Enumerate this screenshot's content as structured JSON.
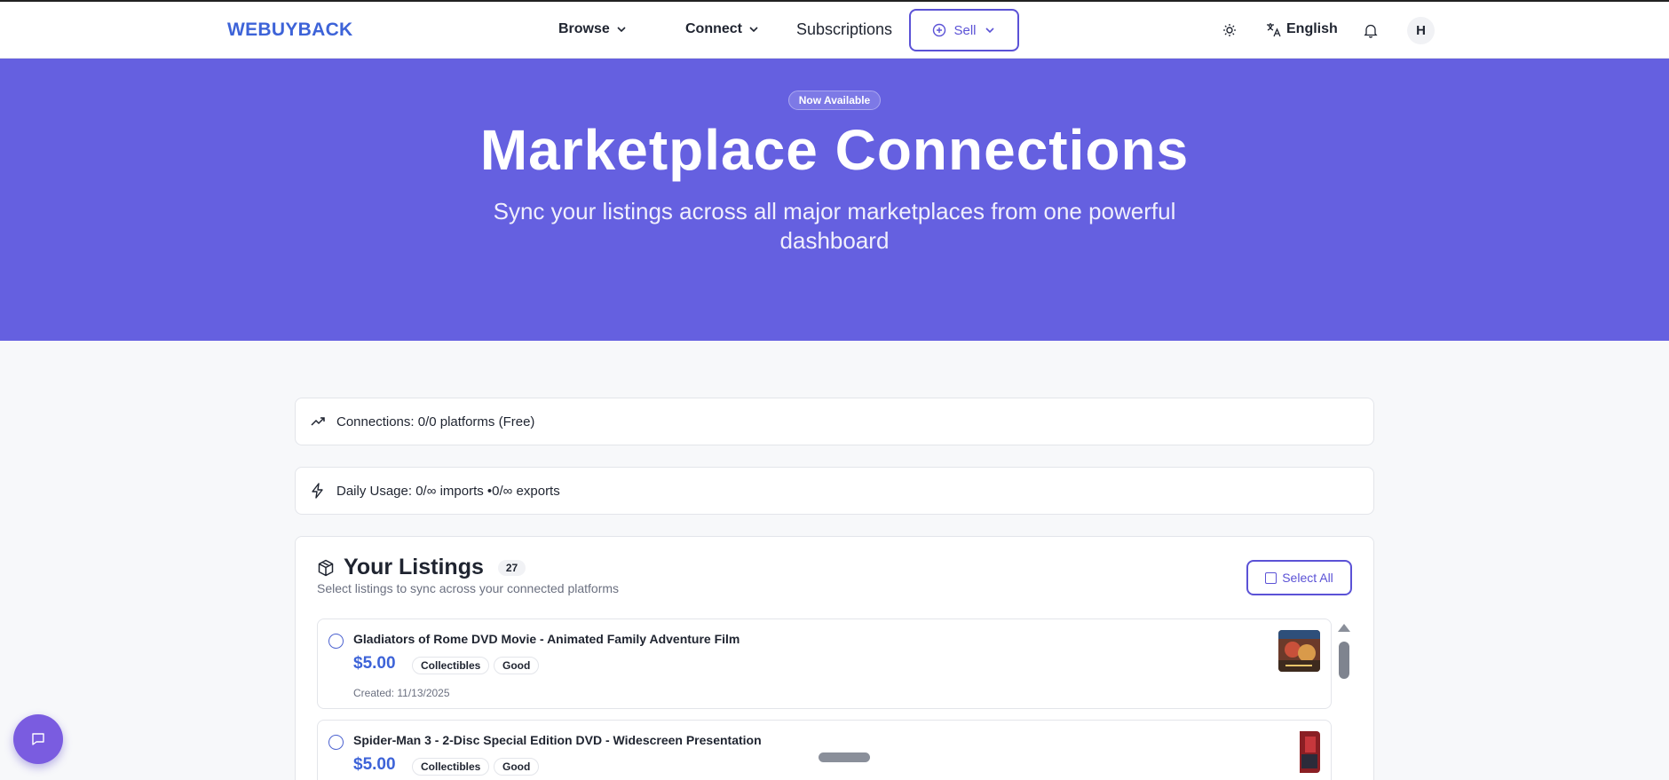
{
  "nav": {
    "logo": "WEBUYBACK",
    "browse": "Browse",
    "connect": "Connect",
    "subscriptions": "Subscriptions",
    "sell": "Sell",
    "language": "English",
    "avatar_initial": "H"
  },
  "hero": {
    "badge": "Now Available",
    "title": "Marketplace Connections",
    "subtitle": "Sync your listings across all major marketplaces from one powerful dashboard",
    "background_color": "#6560e0"
  },
  "stats": {
    "connections": "Connections: 0/0 platforms (Free)",
    "daily_usage": "Daily Usage: 0/∞ imports •0/∞ exports"
  },
  "listings": {
    "title": "Your Listings",
    "count": "27",
    "subtitle": "Select listings to sync across your connected platforms",
    "select_all": "Select All",
    "items": [
      {
        "title": "Gladiators of Rome DVD Movie - Animated Family Adventure Film",
        "price": "$5.00",
        "category": "Collectibles",
        "condition": "Good",
        "created": "Created: 11/13/2025"
      },
      {
        "title": "Spider-Man 3 - 2-Disc Special Edition DVD - Widescreen Presentation",
        "price": "$5.00",
        "category": "Collectibles",
        "condition": "Good"
      }
    ]
  },
  "colors": {
    "accent": "#5b52d6",
    "link_blue": "#3d63d8",
    "chat_button": "#7a5ce0"
  }
}
